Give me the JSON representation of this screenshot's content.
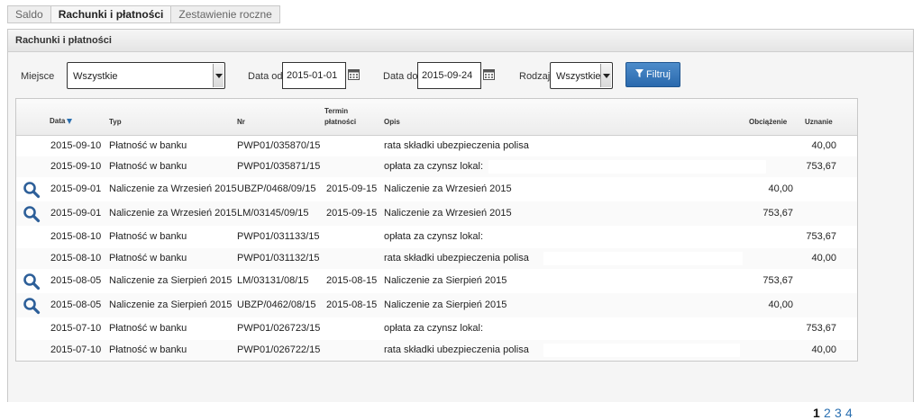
{
  "tabs": [
    {
      "label": "Saldo",
      "active": false
    },
    {
      "label": "Rachunki i płatności",
      "active": true
    },
    {
      "label": "Zestawienie roczne",
      "active": false
    }
  ],
  "panel": {
    "title": "Rachunki i płatności"
  },
  "filters": {
    "place_label": "Miejsce",
    "place_value": "Wszystkie",
    "date_from_label": "Data od",
    "date_from_value": "2015-01-01",
    "date_to_label": "Data do",
    "date_to_value": "2015-09-24",
    "kind_label": "Rodzaj",
    "kind_value": "Wszystkie",
    "filter_button": "Filtruj"
  },
  "table": {
    "headers": {
      "date": "Data",
      "type": "Typ",
      "nr": "Nr",
      "due_line1": "Termin",
      "due_line2": "płatności",
      "desc": "Opis",
      "debit": "Obciążenie",
      "credit": "Uznanie"
    },
    "rows": [
      {
        "icon": false,
        "date": "2015-09-10",
        "type": "Płatność w banku",
        "nr": "PWP01/035870/15",
        "due": "",
        "desc": "rata składki ubezpieczenia polisa",
        "debit": "",
        "credit": "40,00"
      },
      {
        "icon": false,
        "date": "2015-09-10",
        "type": "Płatność w banku",
        "nr": "PWP01/035871/15",
        "due": "",
        "desc": "opłata za czynsz lokal:",
        "debit": "",
        "credit": "753,67"
      },
      {
        "icon": true,
        "date": "2015-09-01",
        "type": "Naliczenie za Wrzesień 2015",
        "nr": "UBZP/0468/09/15",
        "due": "2015-09-15",
        "desc": "Naliczenie za Wrzesień 2015",
        "debit": "40,00",
        "credit": ""
      },
      {
        "icon": true,
        "date": "2015-09-01",
        "type": "Naliczenie za Wrzesień 2015",
        "nr": "LM/03145/09/15",
        "due": "2015-09-15",
        "desc": "Naliczenie za Wrzesień 2015",
        "debit": "753,67",
        "credit": ""
      },
      {
        "icon": false,
        "date": "2015-08-10",
        "type": "Płatność w banku",
        "nr": "PWP01/031133/15",
        "due": "",
        "desc": "opłata za czynsz lokal:",
        "debit": "",
        "credit": "753,67"
      },
      {
        "icon": false,
        "date": "2015-08-10",
        "type": "Płatność w banku",
        "nr": "PWP01/031132/15",
        "due": "",
        "desc": "rata składki ubezpieczenia polisa",
        "debit": "",
        "credit": "40,00"
      },
      {
        "icon": true,
        "date": "2015-08-05",
        "type": "Naliczenie za Sierpień 2015",
        "nr": "LM/03131/08/15",
        "due": "2015-08-15",
        "desc": "Naliczenie za Sierpień 2015",
        "debit": "753,67",
        "credit": ""
      },
      {
        "icon": true,
        "date": "2015-08-05",
        "type": "Naliczenie za Sierpień 2015",
        "nr": "UBZP/0462/08/15",
        "due": "2015-08-15",
        "desc": "Naliczenie za Sierpień 2015",
        "debit": "40,00",
        "credit": ""
      },
      {
        "icon": false,
        "date": "2015-07-10",
        "type": "Płatność w banku",
        "nr": "PWP01/026723/15",
        "due": "",
        "desc": "opłata za czynsz lokal:",
        "debit": "",
        "credit": "753,67"
      },
      {
        "icon": false,
        "date": "2015-07-10",
        "type": "Płatność w banku",
        "nr": "PWP01/026722/15",
        "due": "",
        "desc": "rata składki ubezpieczenia polisa",
        "debit": "",
        "credit": "40,00"
      }
    ]
  },
  "pagination": {
    "pages": [
      "1",
      "2",
      "3",
      "4"
    ],
    "current": "1"
  },
  "colors": {
    "accent": "#2a69ad",
    "link": "#2a6fb0"
  }
}
